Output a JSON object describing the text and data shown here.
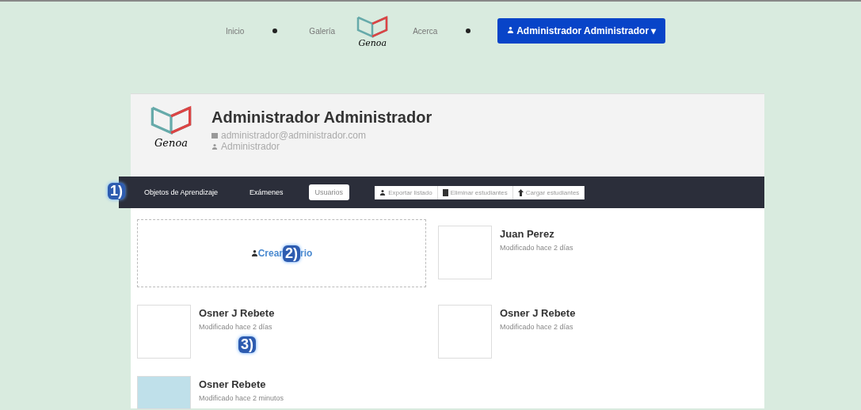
{
  "nav": {
    "links": [
      {
        "label": "Inicio"
      },
      {
        "label": "Galería"
      },
      {
        "label": "Acerca"
      }
    ],
    "logo_text": "Genoa",
    "user_button": {
      "label": "Administrador Administrador",
      "caret": "▾"
    }
  },
  "profile": {
    "name": "Administrador Administrador",
    "email": "administrador@administrador.com",
    "role": "Administrador",
    "logo_text": "Genoa"
  },
  "tabs": [
    {
      "label": "Objetos de Aprendizaje",
      "selected": false
    },
    {
      "label": "Exámenes",
      "selected": false
    },
    {
      "label": "Usuarios",
      "selected": true
    }
  ],
  "actions": [
    {
      "label": "Exportar listado",
      "kind": "export"
    },
    {
      "label": "Eliminar estudiantes",
      "kind": "delete"
    },
    {
      "label": "Cargar estudiantes",
      "kind": "upload"
    }
  ],
  "create_user": {
    "label_start": "Crear",
    "label_end": "rio"
  },
  "users": [
    {
      "name": "Juan Perez",
      "modified": "Modificado hace 2 días",
      "kind": "blank"
    },
    {
      "name": "Osner J Rebete",
      "modified": "Modificado hace 2 días",
      "kind": "blank"
    },
    {
      "name": "Osner J Rebete",
      "modified": "Modificado hace 2 días",
      "kind": "blank"
    },
    {
      "name": "Osner Rebete",
      "modified": "Modificado hace 2 minutos",
      "kind": "photo"
    }
  ],
  "callouts": [
    "1)",
    "2)",
    "3)"
  ]
}
